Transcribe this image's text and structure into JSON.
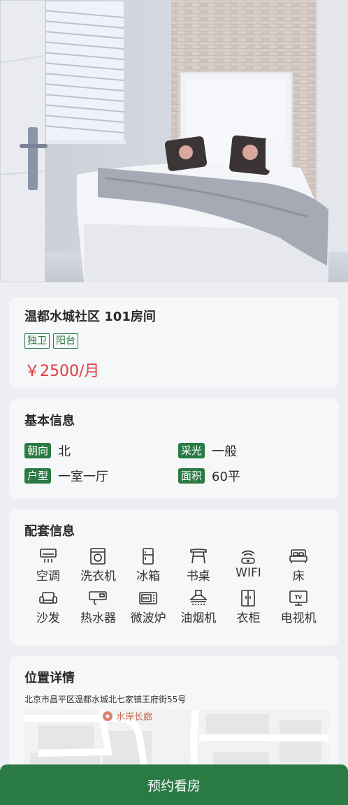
{
  "listing": {
    "title": "温都水城社区 101房间",
    "tags": [
      "独卫",
      "阳台"
    ],
    "price": "￥2500/月"
  },
  "basic_info": {
    "section_title": "基本信息",
    "items": [
      {
        "label": "朝向",
        "value": "北"
      },
      {
        "label": "采光",
        "value": "一般"
      },
      {
        "label": "户型",
        "value": "一室一厅"
      },
      {
        "label": "面积",
        "value": "60平"
      }
    ]
  },
  "facilities": {
    "section_title": "配套信息",
    "items": [
      {
        "label": "空调",
        "icon": "air-conditioner-icon"
      },
      {
        "label": "洗衣机",
        "icon": "washing-machine-icon"
      },
      {
        "label": "冰箱",
        "icon": "fridge-icon"
      },
      {
        "label": "书桌",
        "icon": "desk-icon"
      },
      {
        "label": "WIFI",
        "icon": "wifi-icon"
      },
      {
        "label": "床",
        "icon": "bed-icon"
      },
      {
        "label": "沙发",
        "icon": "sofa-icon"
      },
      {
        "label": "热水器",
        "icon": "water-heater-icon"
      },
      {
        "label": "微波炉",
        "icon": "microwave-icon"
      },
      {
        "label": "油烟机",
        "icon": "range-hood-icon"
      },
      {
        "label": "衣柜",
        "icon": "wardrobe-icon"
      },
      {
        "label": "电视机",
        "icon": "tv-icon"
      }
    ]
  },
  "location": {
    "section_title": "位置详情",
    "address": "北京市昌平区温都水城北七家镇王府街55号",
    "map_poi": "水岸长廊"
  },
  "cta": {
    "label": "预约看房"
  },
  "colors": {
    "accent": "#2a7a43",
    "price": "#e23b3b",
    "background": "#eceef1"
  }
}
